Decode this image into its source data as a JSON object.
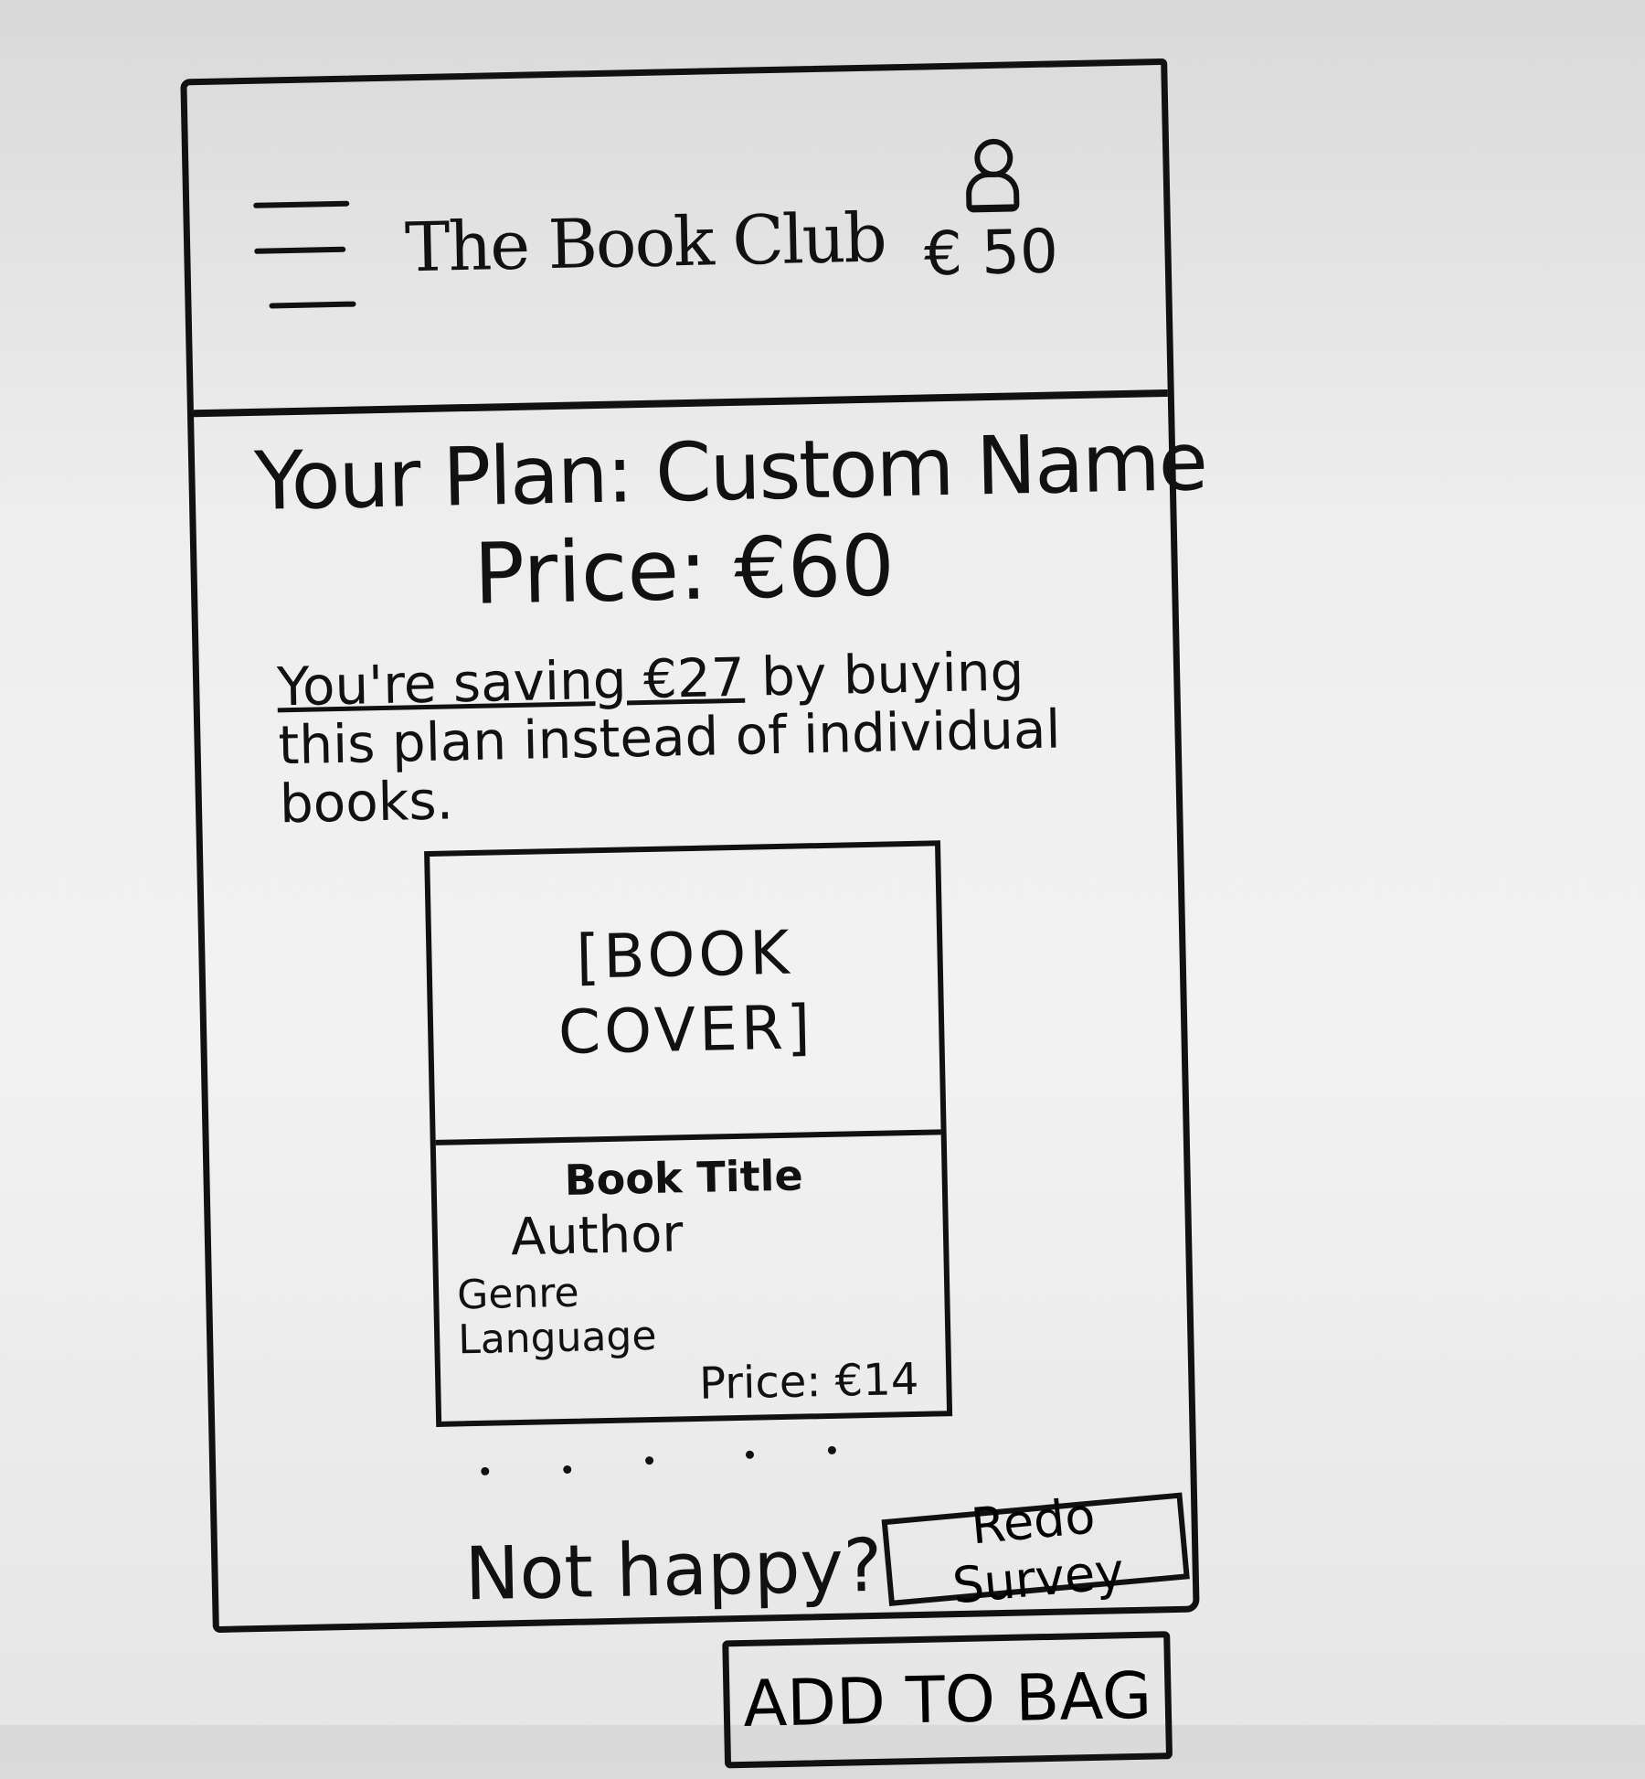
{
  "header": {
    "title": "The Book Club",
    "balance": "€ 50",
    "menu_icon": "hamburger-menu-icon",
    "user_icon": "user-icon"
  },
  "plan": {
    "title": "Your Plan: Custom Name",
    "price": "Price: €60",
    "savings_highlight": "You're saving €27",
    "savings_rest": " by buying this plan instead of individual books."
  },
  "book": {
    "cover": "[BOOK COVER]",
    "title": "Book Title",
    "author": "Author",
    "genre": "Genre",
    "language": "Language",
    "price": "Price: €14"
  },
  "footer": {
    "not_happy": "Not happy?",
    "redo_label": "Redo Survey",
    "add_to_bag_label": "ADD TO BAG"
  }
}
